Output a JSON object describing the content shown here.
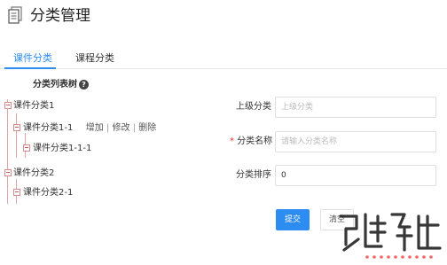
{
  "header": {
    "title": "分类管理",
    "icon": "document-icon"
  },
  "tabs": [
    {
      "label": "课件分类",
      "active": true
    },
    {
      "label": "课程分类",
      "active": false
    }
  ],
  "tree": {
    "title": "分类列表树",
    "help_icon_text": "?",
    "nodes": [
      {
        "label": "课件分类1",
        "level": 0
      },
      {
        "label": "课件分类1-1",
        "level": 1,
        "actions": [
          "增加",
          "修改",
          "删除"
        ],
        "separator": "|"
      },
      {
        "label": "课件分类1-1-1",
        "level": 2
      },
      {
        "label": "课件分类2",
        "level": 0
      },
      {
        "label": "课件分类2-1",
        "level": 1
      }
    ]
  },
  "form": {
    "parent": {
      "label": "上级分类",
      "placeholder": "上级分类",
      "disabled": true
    },
    "name": {
      "required_mark": "*",
      "label": "分类名称",
      "placeholder": "请输入分类名称"
    },
    "order": {
      "label": "分类排序",
      "value": "0"
    },
    "submit_label": "提交",
    "clear_label": "清空"
  },
  "colors": {
    "accent": "#2d8cf0",
    "tree_line": "#e2a3a3",
    "required": "#ee3333"
  }
}
